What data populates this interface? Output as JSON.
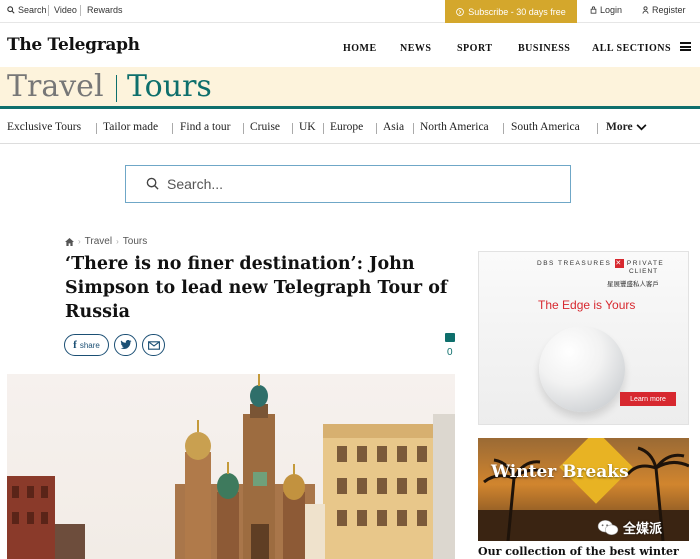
{
  "topbar": {
    "search": "Search",
    "video": "Video",
    "rewards": "Rewards",
    "subscribe": "Subscribe - 30 days free",
    "login": "Login",
    "register": "Register"
  },
  "masthead": {
    "logo": "The Telegraph",
    "nav": [
      "HOME",
      "NEWS",
      "SPORT",
      "BUSINESS",
      "ALL SECTIONS"
    ]
  },
  "section": {
    "travel": "Travel",
    "tours": "Tours"
  },
  "subnav": {
    "items": [
      "Exclusive Tours",
      "Tailor made",
      "Find a tour",
      "Cruise",
      "UK",
      "Europe",
      "Asia",
      "North America",
      "South America"
    ],
    "more": "More"
  },
  "search": {
    "placeholder": "Search..."
  },
  "breadcrumb": [
    "Travel",
    "Tours"
  ],
  "article": {
    "headline": "‘There is no finer destination’: John Simpson to lead new Telegraph Tour of Russia",
    "share_label": "share",
    "comment_count": "0"
  },
  "ads": {
    "dbs_brand": "DBS TREASURES",
    "dbs_private": "PRIVATE",
    "dbs_client": "CLIENT",
    "dbs_chinese": "星展豐盛私人客戶",
    "dbs_tagline": "The Edge is Yours",
    "dbs_cta": "Learn more",
    "winter_breaks": "Winter Breaks",
    "collection": "Our collection of the best winter"
  },
  "watermark": {
    "text": "全媒派"
  },
  "colors": {
    "accent": "#0e6f6c",
    "subscribe": "#d4a72c",
    "dbs_red": "#d7282f"
  }
}
